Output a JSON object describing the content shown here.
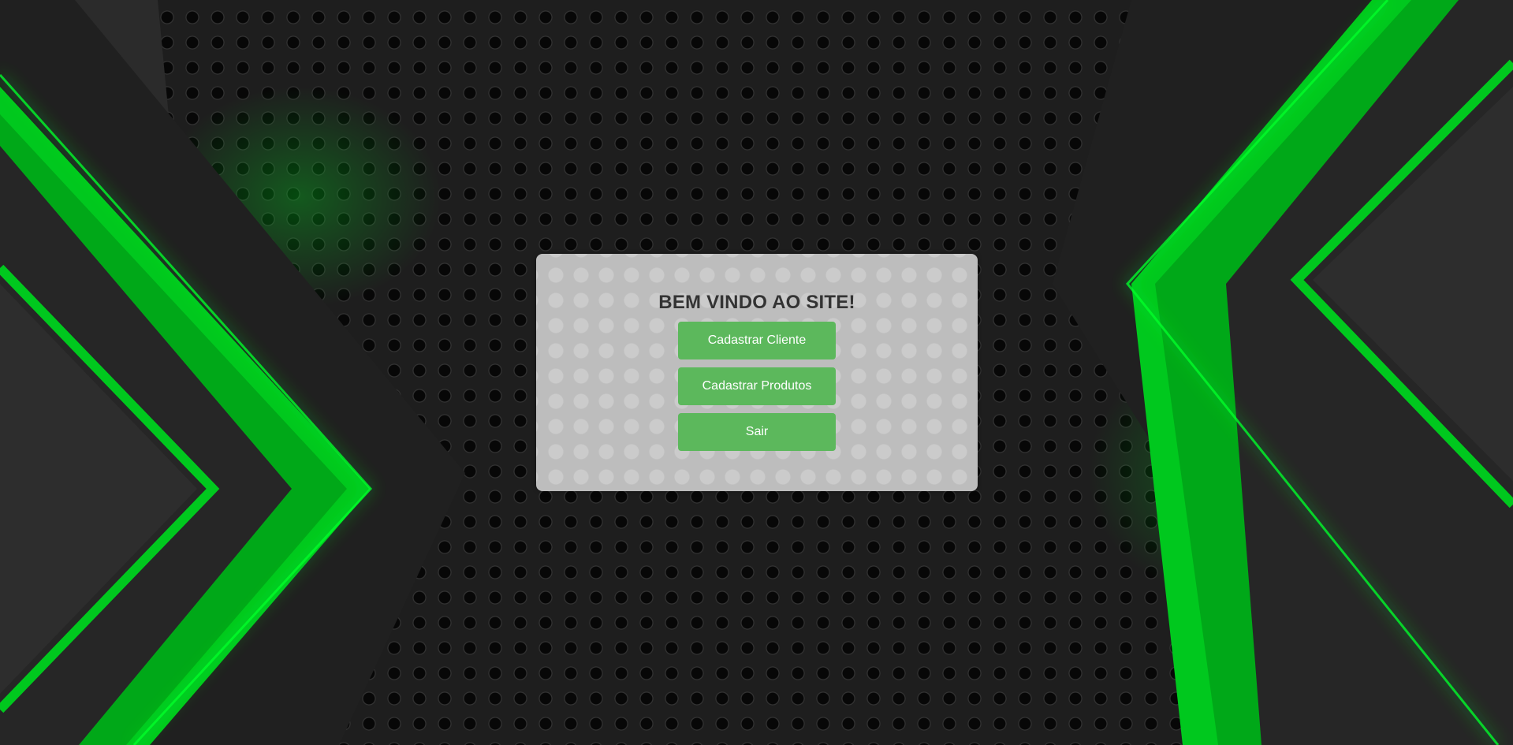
{
  "welcome": {
    "title": "BEM VINDO AO SITE!"
  },
  "menu": {
    "buttons": [
      {
        "label": "Cadastrar Cliente"
      },
      {
        "label": "Cadastrar Produtos"
      },
      {
        "label": "Sair"
      }
    ]
  },
  "colors": {
    "accent": "#5cb85c",
    "neon": "#00e61e",
    "card": "#bdbdbd",
    "background": "#1e1e1e"
  }
}
